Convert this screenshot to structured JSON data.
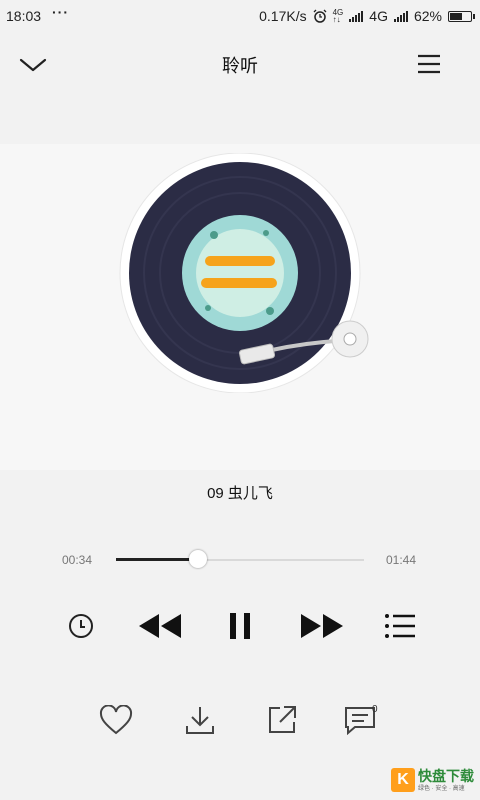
{
  "status_bar": {
    "time": "18:03",
    "dots": "···",
    "speed": "0.17K/s",
    "network": "4G",
    "battery_text": "62%",
    "battery_level": 0.62
  },
  "header": {
    "title": "聆听"
  },
  "player": {
    "song_title": "09 虫儿飞",
    "current_time": "00:34",
    "total_time": "01:44",
    "progress": 0.33
  },
  "actions": {
    "comment_count": "0"
  },
  "watermark": {
    "letter": "K",
    "title": "快盘下载",
    "slogan": "绿色 · 安全 · 高速"
  }
}
